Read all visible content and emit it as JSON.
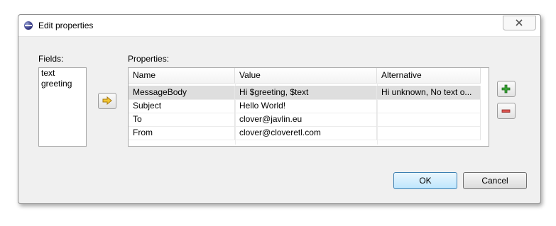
{
  "window": {
    "title": "Edit properties"
  },
  "fields": {
    "label": "Fields:",
    "items": [
      "text",
      "greeting"
    ]
  },
  "properties": {
    "label": "Properties:",
    "columns": [
      "Name",
      "Value",
      "Alternative"
    ],
    "rows": [
      {
        "name": "MessageBody",
        "value": "Hi $greeting, $text",
        "alternative": "Hi unknown, No text o...",
        "selected": true
      },
      {
        "name": "Subject",
        "value": "Hello World!",
        "alternative": ""
      },
      {
        "name": "To",
        "value": "clover@javlin.eu",
        "alternative": ""
      },
      {
        "name": "From",
        "value": "clover@cloveretl.com",
        "alternative": ""
      }
    ]
  },
  "buttons": {
    "ok": "OK",
    "cancel": "Cancel"
  },
  "icons": {
    "app": "eclipse-icon",
    "close": "close-icon",
    "move": "arrow-right-icon",
    "add": "plus-icon",
    "remove": "minus-icon"
  },
  "colors": {
    "arrow": "#f2c531",
    "add": "#3aa537",
    "remove": "#d9534f",
    "selection": "#dedede"
  }
}
